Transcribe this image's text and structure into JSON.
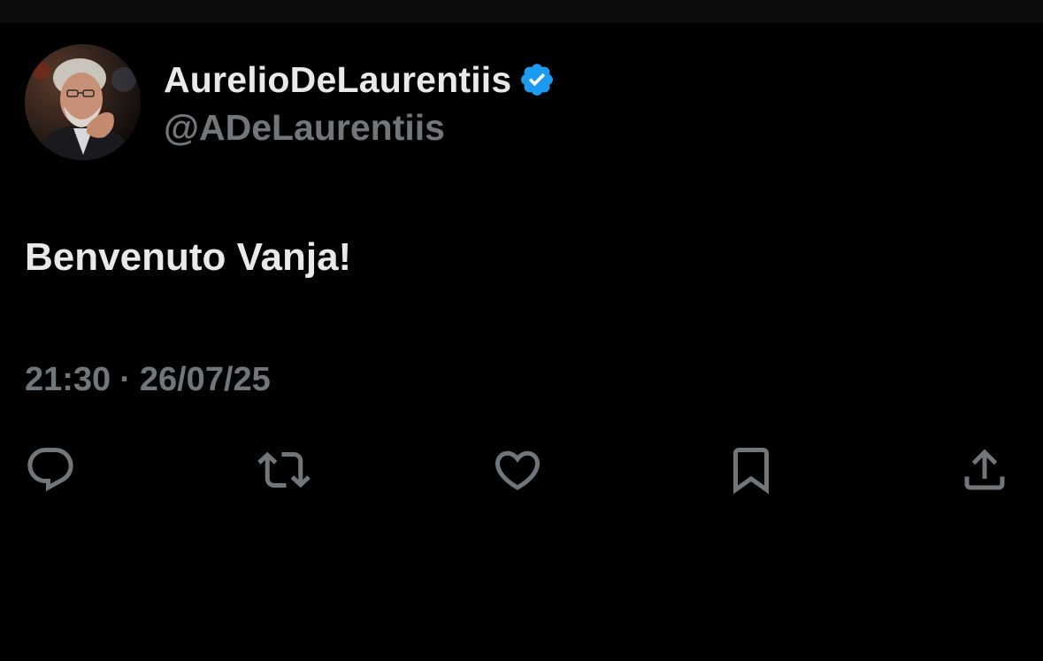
{
  "author": {
    "display_name": "AurelioDeLaurentiis",
    "handle": "@ADeLaurentiis",
    "verified_icon": "verified-badge-icon",
    "verified_color": "#1d9bf0"
  },
  "tweet": {
    "text": "Benvenuto Vanja!",
    "time": "21:30",
    "separator": "·",
    "date": "26/07/25"
  },
  "actions": [
    {
      "name": "reply",
      "icon": "reply-icon"
    },
    {
      "name": "retweet",
      "icon": "retweet-icon"
    },
    {
      "name": "like",
      "icon": "heart-icon"
    },
    {
      "name": "bookmark",
      "icon": "bookmark-icon"
    },
    {
      "name": "share",
      "icon": "share-icon"
    }
  ],
  "colors": {
    "background": "#000000",
    "primary_text": "#e7e9ea",
    "secondary_text": "#71767b",
    "icon": "#71767b",
    "accent": "#1d9bf0"
  }
}
